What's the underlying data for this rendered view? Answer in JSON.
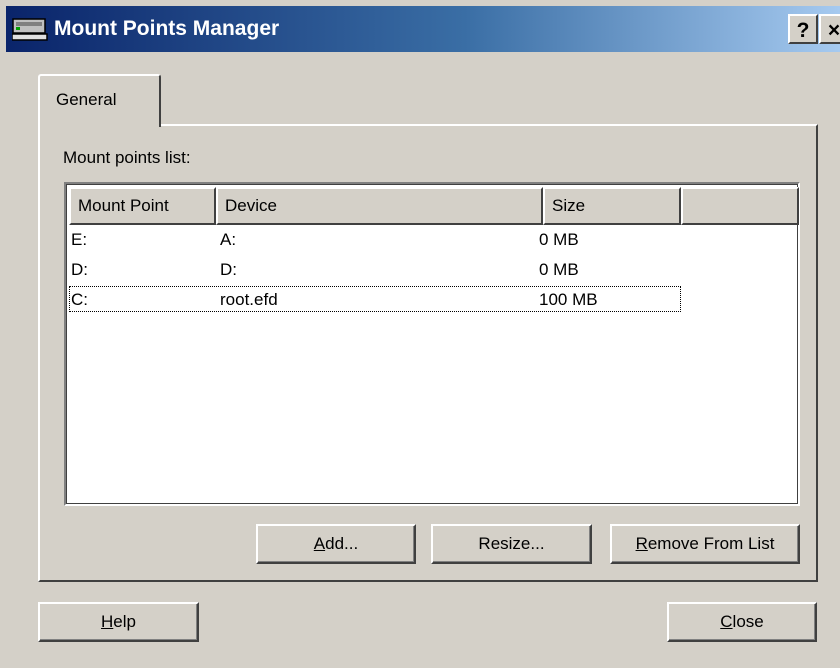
{
  "window": {
    "title": "Mount Points Manager",
    "help_button": "?",
    "close_button": "×"
  },
  "tabs": [
    {
      "label": "General",
      "selected": true
    }
  ],
  "list": {
    "label": "Mount points list:",
    "columns": [
      "Mount Point",
      "Device",
      "Size",
      ""
    ],
    "rows": [
      {
        "mount_point": "E:",
        "device": "A:",
        "size": "0 MB"
      },
      {
        "mount_point": "D:",
        "device": "D:",
        "size": "0 MB"
      },
      {
        "mount_point": "C:",
        "device": "root.efd",
        "size": "100 MB",
        "focused": true
      }
    ]
  },
  "buttons": {
    "add": {
      "mnemonic": "A",
      "rest": "dd..."
    },
    "resize": {
      "label": "Resize..."
    },
    "remove": {
      "mnemonic": "R",
      "rest": "emove From List"
    },
    "help": {
      "mnemonic": "H",
      "rest": "elp"
    },
    "close": {
      "mnemonic": "C",
      "rest": "lose"
    }
  }
}
